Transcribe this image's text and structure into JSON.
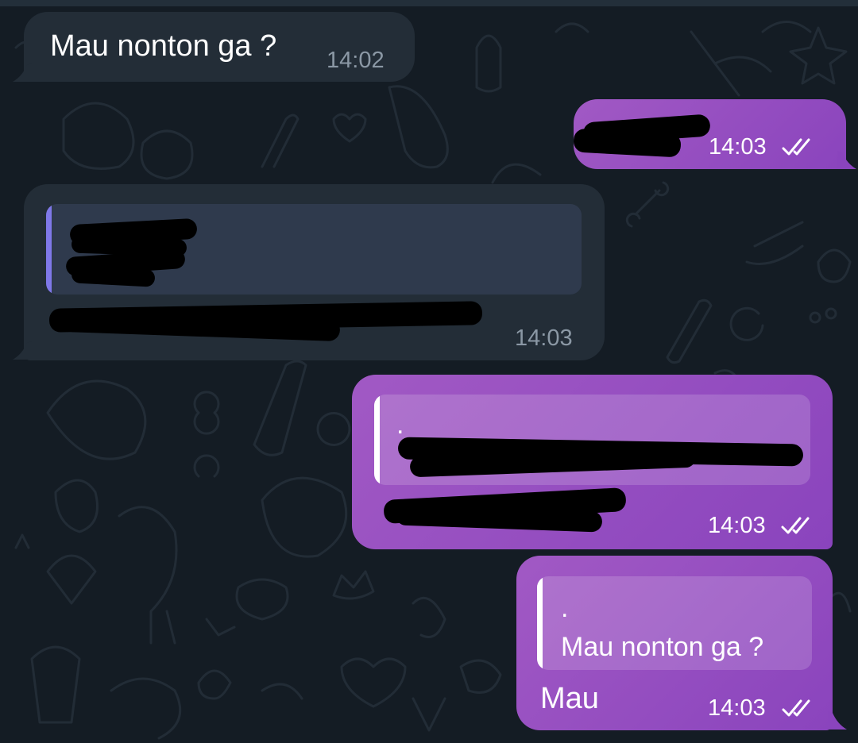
{
  "colors": {
    "background": "#141c24",
    "incoming_bubble": "#232d37",
    "outgoing_bubble": "#9a50c2",
    "incoming_quote_bar": "#7f78e8"
  },
  "messages": [
    {
      "direction": "incoming",
      "text": "Mau nonton ga ?",
      "time": "14:02"
    },
    {
      "direction": "outgoing",
      "text": "",
      "redacted": true,
      "time": "14:03",
      "status_icon": "double-check-icon"
    },
    {
      "direction": "incoming",
      "reply_redacted": true,
      "text": "",
      "redacted": true,
      "time": "14:03"
    },
    {
      "direction": "outgoing",
      "reply_line1": ".",
      "reply_redacted": true,
      "text": "",
      "redacted": true,
      "time": "14:03",
      "status_icon": "double-check-icon"
    },
    {
      "direction": "outgoing",
      "reply_line1": ".",
      "reply_line2": "Mau nonton ga ?",
      "text": "Mau",
      "time": "14:03",
      "status_icon": "double-check-icon"
    }
  ]
}
